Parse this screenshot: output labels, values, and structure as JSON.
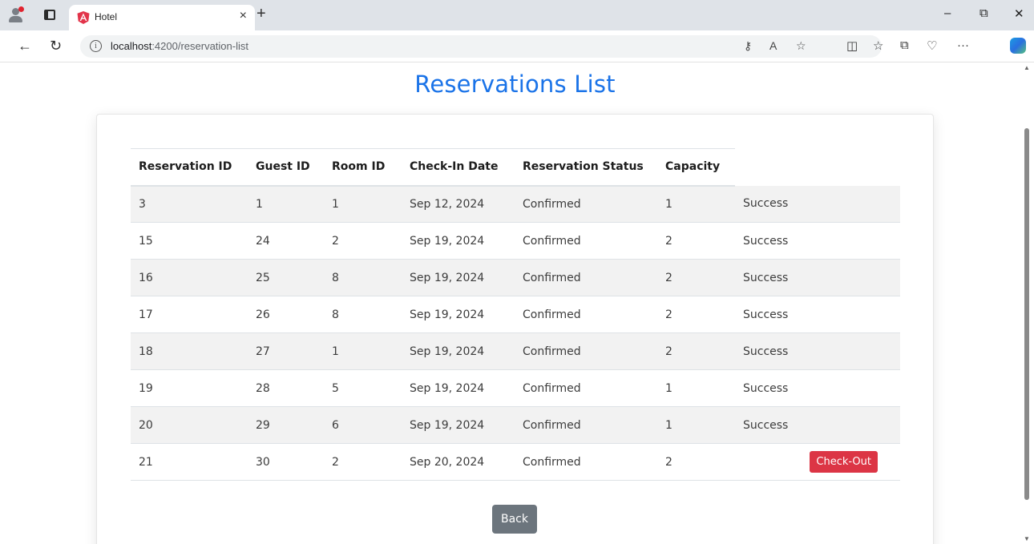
{
  "browser": {
    "tab_title": "Hotel",
    "tab_close": "×",
    "new_tab": "+",
    "url_host": "localhost",
    "url_path": ":4200/reservation-list",
    "window_minimize": "–",
    "window_restore": "⧉",
    "window_close": "✕",
    "back": "←",
    "reload": "↻",
    "more": "···"
  },
  "page": {
    "title": "Reservations List",
    "back_label": "Back"
  },
  "table": {
    "headers": [
      "Reservation ID",
      "Guest ID",
      "Room ID",
      "Check-In Date",
      "Reservation Status",
      "Capacity"
    ],
    "rows": [
      {
        "reservation_id": "3",
        "guest_id": "1",
        "room_id": "1",
        "check_in": "Sep 12, 2024",
        "status": "Confirmed",
        "capacity": "1",
        "action": "Success"
      },
      {
        "reservation_id": "15",
        "guest_id": "24",
        "room_id": "2",
        "check_in": "Sep 19, 2024",
        "status": "Confirmed",
        "capacity": "2",
        "action": "Success"
      },
      {
        "reservation_id": "16",
        "guest_id": "25",
        "room_id": "8",
        "check_in": "Sep 19, 2024",
        "status": "Confirmed",
        "capacity": "2",
        "action": "Success"
      },
      {
        "reservation_id": "17",
        "guest_id": "26",
        "room_id": "8",
        "check_in": "Sep 19, 2024",
        "status": "Confirmed",
        "capacity": "2",
        "action": "Success"
      },
      {
        "reservation_id": "18",
        "guest_id": "27",
        "room_id": "1",
        "check_in": "Sep 19, 2024",
        "status": "Confirmed",
        "capacity": "2",
        "action": "Success"
      },
      {
        "reservation_id": "19",
        "guest_id": "28",
        "room_id": "5",
        "check_in": "Sep 19, 2024",
        "status": "Confirmed",
        "capacity": "1",
        "action": "Success"
      },
      {
        "reservation_id": "20",
        "guest_id": "29",
        "room_id": "6",
        "check_in": "Sep 19, 2024",
        "status": "Confirmed",
        "capacity": "1",
        "action": "Success"
      },
      {
        "reservation_id": "21",
        "guest_id": "30",
        "room_id": "2",
        "check_in": "Sep 20, 2024",
        "status": "Confirmed",
        "capacity": "2",
        "action": "Check-Out"
      }
    ]
  },
  "colors": {
    "title": "#1a73e8",
    "checkout": "#dc3545",
    "back": "#6c757d"
  }
}
